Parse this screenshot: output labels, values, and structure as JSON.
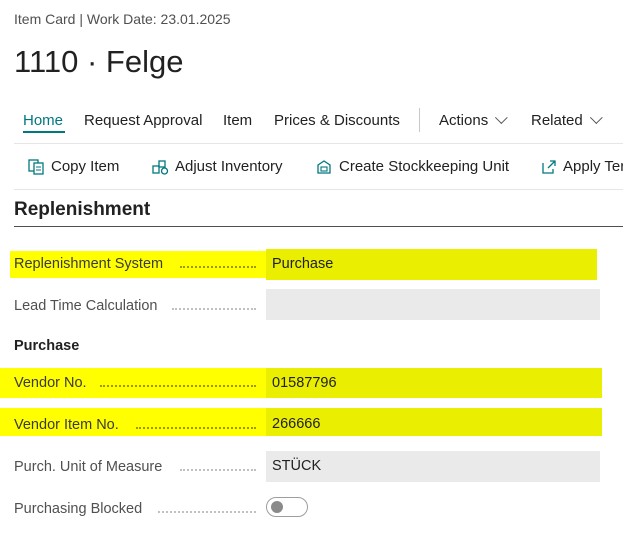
{
  "header": {
    "breadcrumb": "Item Card | Work Date: 23.01.2025",
    "title": "1110 · Felge"
  },
  "nav": {
    "home": "Home",
    "request_approval": "Request Approval",
    "item": "Item",
    "prices_discounts": "Prices & Discounts",
    "actions": "Actions",
    "related": "Related"
  },
  "actions": {
    "copy_item": "Copy Item",
    "adjust_inventory": "Adjust Inventory",
    "create_sku": "Create Stockkeeping Unit",
    "apply_template": "Apply Ter"
  },
  "section": {
    "title": "Replenishment",
    "purchase_heading": "Purchase"
  },
  "fields": {
    "replenishment_system": {
      "label": "Replenishment System",
      "value": "Purchase",
      "highlighted": true
    },
    "lead_time_calculation": {
      "label": "Lead Time Calculation",
      "value": ""
    },
    "vendor_no": {
      "label": "Vendor No.",
      "value": "01587796",
      "highlighted": true
    },
    "vendor_item_no": {
      "label": "Vendor Item No.",
      "value": "266666",
      "highlighted": true
    },
    "purch_unit_of_measure": {
      "label": "Purch. Unit of Measure",
      "value": "STÜCK"
    },
    "purchasing_blocked": {
      "label": "Purchasing Blocked",
      "value": false
    }
  },
  "colors": {
    "accent": "#00787f",
    "highlight": "#ffff00",
    "field_background": "#eaeaea"
  }
}
